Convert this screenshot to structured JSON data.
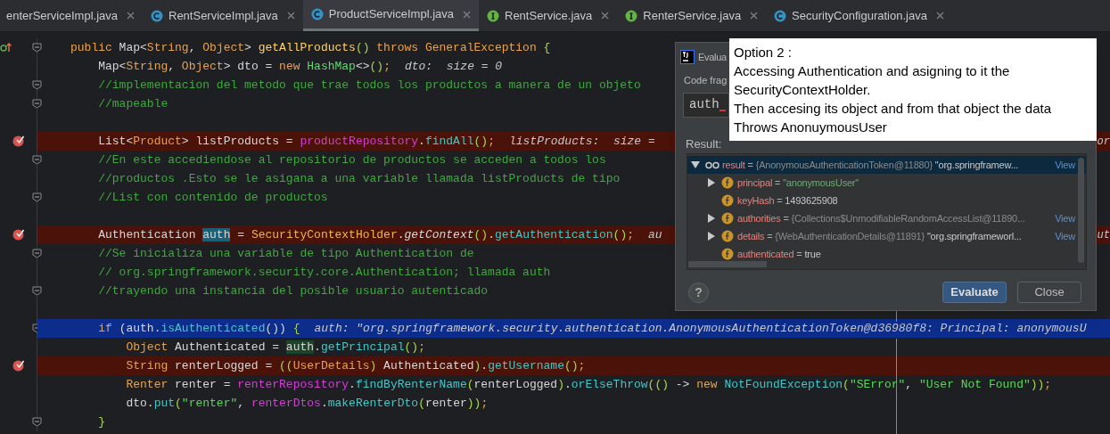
{
  "tabs": [
    {
      "label": "enterServiceImpl.java",
      "selected": false
    },
    {
      "label": "RentServiceImpl.java",
      "selected": false,
      "kind": "class"
    },
    {
      "label": "ProductServiceImpl.java",
      "selected": true,
      "kind": "class"
    },
    {
      "label": "RentService.java",
      "selected": false,
      "kind": "interface"
    },
    {
      "label": "RenterService.java",
      "selected": false,
      "kind": "interface"
    },
    {
      "label": "SecurityConfiguration.java",
      "selected": false,
      "kind": "class"
    }
  ],
  "code_lines": [
    {
      "kind": "code",
      "overridden": true,
      "fold": true,
      "breakpoint": false,
      "current": false,
      "tokens": [
        {
          "kind": "kw",
          "text": "public "
        },
        {
          "kind": "p",
          "text": "Map<"
        },
        {
          "kind": "ty",
          "text": "String"
        },
        {
          "kind": "p",
          "text": ", "
        },
        {
          "kind": "ty",
          "text": "Object"
        },
        {
          "kind": "p",
          "text": "> "
        },
        {
          "kind": "fn",
          "text": "getAllProducts"
        },
        {
          "kind": "br",
          "text": "() "
        },
        {
          "kind": "kw",
          "text": "throws "
        },
        {
          "kind": "ty",
          "text": "GeneralException "
        },
        {
          "kind": "br",
          "text": "{"
        }
      ]
    },
    {
      "kind": "code",
      "overridden": false,
      "fold": false,
      "breakpoint": false,
      "current": false,
      "tokens": [
        {
          "kind": "p",
          "text": "    Map<"
        },
        {
          "kind": "ty",
          "text": "String"
        },
        {
          "kind": "p",
          "text": ", "
        },
        {
          "kind": "ty",
          "text": "Object"
        },
        {
          "kind": "p",
          "text": "> dto = "
        },
        {
          "kind": "kw",
          "text": "new "
        },
        {
          "kind": "cls2",
          "text": "HashMap"
        },
        {
          "kind": "p",
          "text": "<>"
        },
        {
          "kind": "br",
          "text": "()"
        },
        {
          "kind": "semi",
          "text": ";"
        }
      ],
      "hint": "dto:  size = 0"
    },
    {
      "kind": "code",
      "overridden": false,
      "fold": true,
      "breakpoint": false,
      "current": false,
      "tokens": [
        {
          "kind": "cm",
          "text": "    //implementacion del metodo que trae todos los productos a manera de un objeto"
        }
      ]
    },
    {
      "kind": "code",
      "overridden": false,
      "fold": true,
      "breakpoint": false,
      "current": false,
      "tokens": [
        {
          "kind": "cm",
          "text": "    //mapeable"
        }
      ]
    },
    {
      "kind": "blank"
    },
    {
      "kind": "code",
      "overridden": false,
      "fold": false,
      "breakpoint": true,
      "current": false,
      "tokens": [
        {
          "kind": "p",
          "text": "    List<"
        },
        {
          "kind": "ty",
          "text": "Product"
        },
        {
          "kind": "p",
          "text": "> listProducts = "
        },
        {
          "kind": "fld",
          "text": "productRepository"
        },
        {
          "kind": "p",
          "text": "."
        },
        {
          "kind": "call",
          "text": "findAll"
        },
        {
          "kind": "br",
          "text": "()"
        },
        {
          "kind": "semi",
          "text": ";"
        }
      ],
      "hint": "listProducts:  size = ",
      "tail": "or"
    },
    {
      "kind": "code",
      "overridden": false,
      "fold": true,
      "breakpoint": false,
      "current": false,
      "tokens": [
        {
          "kind": "cm",
          "text": "    //En este accediendose al repositorio de productos se acceden a todos los"
        }
      ]
    },
    {
      "kind": "code",
      "overridden": false,
      "fold": false,
      "breakpoint": false,
      "current": false,
      "tokens": [
        {
          "kind": "cm",
          "text": "    //productos .Esto se le asigana a una variable llamada listProducts de tipo"
        }
      ]
    },
    {
      "kind": "code",
      "overridden": false,
      "fold": true,
      "breakpoint": false,
      "current": false,
      "tokens": [
        {
          "kind": "cm",
          "text": "    //List con contenido de productos"
        }
      ]
    },
    {
      "kind": "blank"
    },
    {
      "kind": "code",
      "overridden": false,
      "fold": false,
      "breakpoint": true,
      "current": false,
      "tokens": [
        {
          "kind": "p",
          "text": "    Authentication "
        },
        {
          "kind": "sel",
          "text": "auth"
        },
        {
          "kind": "p",
          "text": " = "
        },
        {
          "kind": "cls",
          "text": "SecurityContextHolder"
        },
        {
          "kind": "p",
          "text": "."
        },
        {
          "kind": "itc",
          "text": "getContext"
        },
        {
          "kind": "br",
          "text": "()"
        },
        {
          "kind": "p",
          "text": "."
        },
        {
          "kind": "call",
          "text": "getAuthentication"
        },
        {
          "kind": "br",
          "text": "()"
        },
        {
          "kind": "semi",
          "text": ";"
        }
      ],
      "hint": "au",
      "tail": "ut"
    },
    {
      "kind": "code",
      "overridden": false,
      "fold": true,
      "breakpoint": false,
      "current": false,
      "tokens": [
        {
          "kind": "cm",
          "text": "    //Se inicializa una variable de tipo Authentication de"
        }
      ]
    },
    {
      "kind": "code",
      "overridden": false,
      "fold": false,
      "breakpoint": false,
      "current": false,
      "tokens": [
        {
          "kind": "cm",
          "text": "    // org.springframework.security.core.Authentication; llamada auth"
        }
      ]
    },
    {
      "kind": "code",
      "overridden": false,
      "fold": true,
      "breakpoint": false,
      "current": false,
      "tokens": [
        {
          "kind": "cm",
          "text": "    //trayendo una instancia del posible usuario autenticado"
        }
      ]
    },
    {
      "kind": "blank"
    },
    {
      "kind": "code",
      "overridden": false,
      "fold": true,
      "breakpoint": false,
      "current": true,
      "tokens": [
        {
          "kind": "kw",
          "text": "    if "
        },
        {
          "kind": "p",
          "text": "(auth."
        },
        {
          "kind": "call",
          "text": "isAuthenticated"
        },
        {
          "kind": "p",
          "text": "()) "
        },
        {
          "kind": "br",
          "text": "{"
        }
      ],
      "hint": "auth: \"org.springframework.security.authentication.AnonymousAuthenticationToken@d36980f8: Principal: anonymousU"
    },
    {
      "kind": "code",
      "overridden": false,
      "fold": false,
      "breakpoint": false,
      "current": false,
      "tokens": [
        {
          "kind": "ty",
          "text": "        Object "
        },
        {
          "kind": "p",
          "text": "Authenticated = "
        },
        {
          "kind": "use",
          "text": "auth"
        },
        {
          "kind": "p",
          "text": "."
        },
        {
          "kind": "call",
          "text": "getPrincipal"
        },
        {
          "kind": "br",
          "text": "()"
        },
        {
          "kind": "semi",
          "text": ";"
        }
      ]
    },
    {
      "kind": "code",
      "overridden": false,
      "fold": false,
      "breakpoint": true,
      "current": false,
      "tokens": [
        {
          "kind": "ty",
          "text": "        String "
        },
        {
          "kind": "p",
          "text": "renterLogged = "
        },
        {
          "kind": "br",
          "text": "(("
        },
        {
          "kind": "ty",
          "text": "UserDetails"
        },
        {
          "kind": "br",
          "text": ") "
        },
        {
          "kind": "p",
          "text": "Authenticated"
        },
        {
          "kind": "br",
          "text": ")"
        },
        {
          "kind": "p",
          "text": "."
        },
        {
          "kind": "call",
          "text": "getUsername"
        },
        {
          "kind": "br",
          "text": "()"
        },
        {
          "kind": "semi",
          "text": ";"
        }
      ]
    },
    {
      "kind": "code",
      "overridden": false,
      "fold": false,
      "breakpoint": false,
      "current": false,
      "tokens": [
        {
          "kind": "ty",
          "text": "        Renter "
        },
        {
          "kind": "p",
          "text": "renter = "
        },
        {
          "kind": "fld",
          "text": "renterRepository"
        },
        {
          "kind": "p",
          "text": "."
        },
        {
          "kind": "call",
          "text": "findByRenterName"
        },
        {
          "kind": "br",
          "text": "("
        },
        {
          "kind": "p",
          "text": "renterLogged"
        },
        {
          "kind": "br",
          "text": ")"
        },
        {
          "kind": "p",
          "text": "."
        },
        {
          "kind": "call",
          "text": "orElseThrow"
        },
        {
          "kind": "br",
          "text": "(()"
        },
        {
          "kind": "p",
          "text": " -> "
        },
        {
          "kind": "kw",
          "text": "new "
        },
        {
          "kind": "call",
          "text": "NotFoundException"
        },
        {
          "kind": "br",
          "text": "("
        },
        {
          "kind": "str",
          "text": "\"SError\""
        },
        {
          "kind": "p",
          "text": ", "
        },
        {
          "kind": "str",
          "text": "\"User Not Found\""
        },
        {
          "kind": "br",
          "text": "))"
        },
        {
          "kind": "semi",
          "text": ";"
        }
      ]
    },
    {
      "kind": "code",
      "overridden": false,
      "fold": false,
      "breakpoint": false,
      "current": false,
      "tokens": [
        {
          "kind": "p",
          "text": "        dto."
        },
        {
          "kind": "call",
          "text": "put"
        },
        {
          "kind": "br",
          "text": "("
        },
        {
          "kind": "str",
          "text": "\"renter\""
        },
        {
          "kind": "p",
          "text": ", "
        },
        {
          "kind": "fld",
          "text": "renterDtos"
        },
        {
          "kind": "p",
          "text": "."
        },
        {
          "kind": "call",
          "text": "makeRenterDto"
        },
        {
          "kind": "br",
          "text": "("
        },
        {
          "kind": "p",
          "text": "renter"
        },
        {
          "kind": "br",
          "text": "))"
        },
        {
          "kind": "semi",
          "text": ";"
        }
      ]
    },
    {
      "kind": "code",
      "overridden": false,
      "fold": true,
      "breakpoint": false,
      "current": false,
      "tokens": [
        {
          "kind": "br",
          "text": "    }"
        }
      ]
    }
  ],
  "dialog": {
    "title": "Evalua",
    "code_label": "Code frag",
    "code_value": "auth",
    "result_label": "Result:",
    "result_tree": [
      {
        "kind": "watch",
        "name": "result",
        "eq": "=",
        "ref": "{AnonymousAuthenticationToken@11880}",
        "value": "\"org.springframew...",
        "string": false,
        "link": "View",
        "expanded": true,
        "selected": true,
        "children": [
          {
            "kind": "field",
            "name": "principal",
            "eq": "=",
            "value": "\"anonymousUser\"",
            "string": true,
            "expanded": false,
            "selected": false
          },
          {
            "kind": "field",
            "name": "keyHash",
            "eq": "=",
            "value": "1493625908",
            "string": false,
            "selected": false
          },
          {
            "kind": "field",
            "name": "authorities",
            "eq": "=",
            "ref": "{Collections$UnmodifiableRandomAccessList@11890...",
            "link": "View",
            "expanded": false,
            "selected": false
          },
          {
            "kind": "field",
            "name": "details",
            "eq": "=",
            "ref": "{WebAuthenticationDetails@11891}",
            "value": "\"org.springframeworl...",
            "string": false,
            "link": "View",
            "expanded": false,
            "selected": false
          },
          {
            "kind": "field",
            "name": "authenticated",
            "eq": "=",
            "value": "true",
            "string": false,
            "selected": false
          }
        ]
      }
    ],
    "help": "?",
    "buttons": [
      {
        "label": "Evaluate",
        "default": true
      },
      {
        "label": "Close",
        "default": false
      }
    ]
  },
  "annotation": [
    "Option 2 :",
    "Accessing Authentication and asigning to it the",
    "SecurityContextHolder.",
    "Then accesing its object and from that object the data",
    "Throws AnonuymousUser"
  ]
}
